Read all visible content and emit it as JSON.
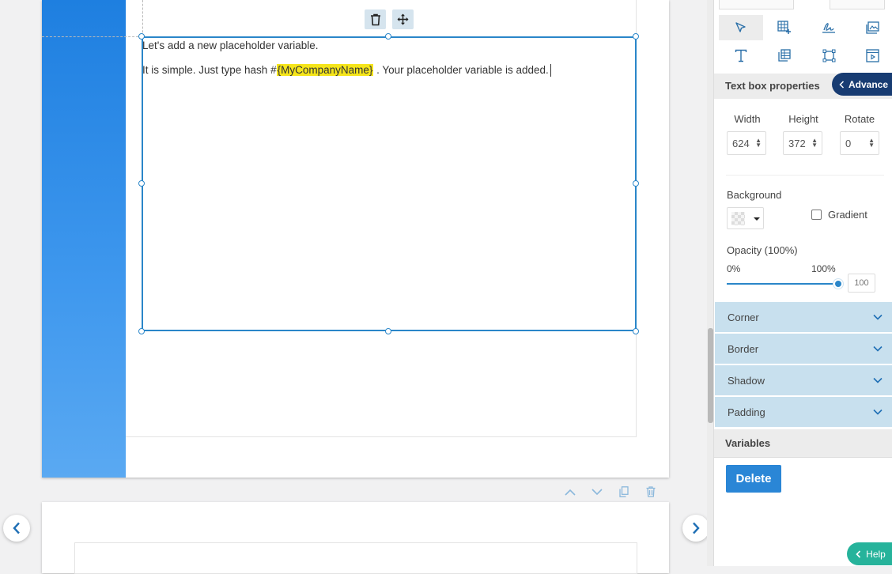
{
  "textbox": {
    "line1": "Let's add a new placeholder variable.",
    "line2_before": "It is simple. Just type hash #",
    "line2_variable": "{MyCompanyName}",
    "line2_after": " . Your placeholder variable is added."
  },
  "panel": {
    "title": "Text box properties",
    "advance_label": "Advance",
    "dimensions": {
      "width_label": "Width",
      "height_label": "Height",
      "rotate_label": "Rotate",
      "width_value": "624",
      "height_value": "372",
      "rotate_value": "0"
    },
    "background_label": "Background",
    "gradient_label": "Gradient",
    "opacity": {
      "label": "Opacity (100%)",
      "min_label": "0%",
      "max_label": "100%",
      "value": "100",
      "fraction": 1.0
    },
    "accordions": [
      "Corner",
      "Border",
      "Shadow",
      "Padding"
    ],
    "variables_label": "Variables",
    "delete_label": "Delete"
  },
  "help_label": "Help",
  "colors": {
    "accent": "#2a86c9",
    "highlight": "#f5e51a",
    "accordion": "#c8e0ee",
    "advance": "#183c72",
    "help": "#26b39b",
    "strip": "#1e7fe0"
  }
}
